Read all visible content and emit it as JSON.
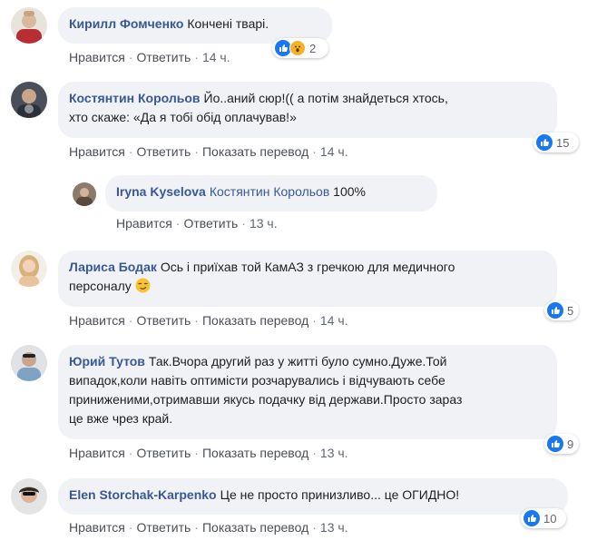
{
  "actions": {
    "like": "Нравится",
    "reply": "Ответить",
    "translate": "Показать перевод"
  },
  "comments": [
    {
      "author": "Кирилл Фомченко",
      "text": "Кончені тварі.",
      "time": "14 ч.",
      "reactions": "2"
    },
    {
      "author": "Костянтин Корольов",
      "text_line1": "Йо..аний сюр!(( а потім знайдеться хтось,",
      "text_line2": "хто скаже: «Да я тобі обід оплачував!»",
      "time": "14 ч.",
      "reactions": "15"
    },
    {
      "author": "Iryna Kyselova",
      "mention": "Костянтин Корольов",
      "text": "100%",
      "time": "13 ч."
    },
    {
      "author": "Лариса Бодак",
      "text_line1": "Ось і приїхав той КамАЗ з гречкою для медичного",
      "text_line2": "персоналу",
      "time": "14 ч.",
      "reactions": "5"
    },
    {
      "author": "Юрий Тутов",
      "text_line1": "Так.Вчора другий раз у житті було сумно.Дуже.Той",
      "text_line2": "випадок,коли навіть оптимісти розчарувались і відчувають себе",
      "text_line3": "приниженими,отримавши якусь подачку від держави.Просто зараз",
      "text_line4": "це вже чрез край.",
      "time": "13 ч.",
      "reactions": "9"
    },
    {
      "author": "Elen Storchak-Karpenko",
      "text": "Це не просто принизливо... це ОГИДНО!",
      "time": "13 ч.",
      "reactions": "10"
    }
  ],
  "colors": {
    "author": "#385898",
    "bubble": "#f0f2f5",
    "like": "#1877f2",
    "meta": "#606770"
  }
}
